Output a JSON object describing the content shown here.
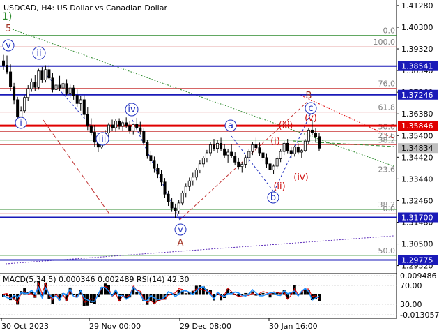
{
  "header": {
    "symbol": "USDCAD",
    "timeframe": "H4",
    "description": "US Dollar vs Canadian Dollar"
  },
  "colors": {
    "navy": "#1a1ab8",
    "red": "#e00000",
    "green": "#2e8b2e",
    "wave_blue": "#1f2fbf",
    "wave_red": "#d01010",
    "wave_brown": "#a03020",
    "fib_gray": "#808080",
    "candle": "#000000",
    "macd_hist": "#000000",
    "macd_signal": "#e00000",
    "rsi_line": "#1e90ff"
  },
  "chart_data": {
    "type": "candlestick",
    "symbol": "USDCAD",
    "timeframe": "H4",
    "y_range": [
      1.2916,
      1.4153
    ],
    "price_ticks": [
      "1.41280",
      "1.40300",
      "1.39320",
      "1.38340",
      "1.37360",
      "1.36380",
      "1.35400",
      "1.34420",
      "1.33440",
      "1.32460",
      "1.31480",
      "1.30500",
      "1.29520"
    ],
    "time_ticks": [
      "30 Oct 2023",
      "29 Nov 00:00",
      "29 Dec 08:00",
      "30 Jan 16:00"
    ],
    "levels": [
      {
        "price": 1.38541,
        "label": "1.38541",
        "color": "navy"
      },
      {
        "price": 1.37246,
        "label": "1.37246",
        "color": "navy"
      },
      {
        "price": 1.35846,
        "label": "1.35846",
        "color": "red"
      },
      {
        "price": 1.34834,
        "label": "1.34834",
        "color": "current"
      },
      {
        "price": 1.317,
        "label": "1.31700",
        "color": "navy"
      },
      {
        "price": 1.29775,
        "label": "1.29775",
        "color": "navy"
      }
    ],
    "fib_levels": [
      {
        "label": "0.0",
        "price": 1.3994,
        "color": "green"
      },
      {
        "label": "100.0",
        "price": 1.3941,
        "color": "red"
      },
      {
        "label": "76.0",
        "price": 1.3754,
        "color": "red"
      },
      {
        "label": "61.8",
        "price": 1.3646,
        "color": "red"
      },
      {
        "label": "50.0",
        "price": 1.3558,
        "color": "red"
      },
      {
        "label": "23.6",
        "price": 1.3519,
        "color": "green"
      },
      {
        "label": "38.2",
        "price": 1.3498,
        "color": "red"
      },
      {
        "label": "23.6",
        "price": 1.3366,
        "color": "red"
      },
      {
        "label": "38.2",
        "price": 1.3206,
        "color": "green"
      },
      {
        "label": "0.0",
        "price": 1.3187,
        "color": "red"
      },
      {
        "label": "50.0",
        "price": 1.2998,
        "color": "green"
      }
    ],
    "candles": [
      [
        1.3878,
        1.3905,
        1.3838,
        1.3858
      ],
      [
        1.3858,
        1.3902,
        1.3818,
        1.3828
      ],
      [
        1.3828,
        1.3862,
        1.3742,
        1.3762
      ],
      [
        1.3762,
        1.3778,
        1.3682,
        1.3702
      ],
      [
        1.3702,
        1.3715,
        1.3605,
        1.3625
      ],
      [
        1.3625,
        1.3672,
        1.3605,
        1.3652
      ],
      [
        1.3652,
        1.3722,
        1.3642,
        1.3712
      ],
      [
        1.3712,
        1.3768,
        1.3698,
        1.3752
      ],
      [
        1.3752,
        1.3798,
        1.3738,
        1.3782
      ],
      [
        1.3782,
        1.3815,
        1.3742,
        1.3758
      ],
      [
        1.3758,
        1.3842,
        1.3748,
        1.3832
      ],
      [
        1.3832,
        1.385,
        1.3778,
        1.3792
      ],
      [
        1.3792,
        1.3858,
        1.378,
        1.3838
      ],
      [
        1.3838,
        1.386,
        1.379,
        1.38
      ],
      [
        1.38,
        1.3822,
        1.3735,
        1.3748
      ],
      [
        1.3748,
        1.379,
        1.3705,
        1.3768
      ],
      [
        1.3768,
        1.381,
        1.3742,
        1.3755
      ],
      [
        1.3755,
        1.3785,
        1.3718,
        1.3775
      ],
      [
        1.3775,
        1.3795,
        1.3722,
        1.3732
      ],
      [
        1.3732,
        1.377,
        1.3712,
        1.3755
      ],
      [
        1.3755,
        1.3768,
        1.3702,
        1.3722
      ],
      [
        1.3722,
        1.3748,
        1.3668,
        1.3685
      ],
      [
        1.3685,
        1.372,
        1.3652,
        1.3702
      ],
      [
        1.3702,
        1.3722,
        1.362,
        1.3635
      ],
      [
        1.3635,
        1.3668,
        1.3565,
        1.3585
      ],
      [
        1.3585,
        1.3618,
        1.354,
        1.3555
      ],
      [
        1.3555,
        1.3588,
        1.349,
        1.351
      ],
      [
        1.351,
        1.3542,
        1.3465,
        1.3488
      ],
      [
        1.3488,
        1.3525,
        1.3478,
        1.3512
      ],
      [
        1.3512,
        1.3565,
        1.35,
        1.3552
      ],
      [
        1.3552,
        1.3598,
        1.3535,
        1.3588
      ],
      [
        1.3588,
        1.3612,
        1.3562,
        1.3575
      ],
      [
        1.3575,
        1.3615,
        1.3558,
        1.3605
      ],
      [
        1.3605,
        1.3618,
        1.3568,
        1.3582
      ],
      [
        1.3582,
        1.3608,
        1.356,
        1.3598
      ],
      [
        1.3598,
        1.3622,
        1.3575,
        1.3585
      ],
      [
        1.3585,
        1.3605,
        1.3548,
        1.3562
      ],
      [
        1.3562,
        1.3595,
        1.3545,
        1.359
      ],
      [
        1.359,
        1.362,
        1.3565,
        1.3575
      ],
      [
        1.3575,
        1.3602,
        1.3545,
        1.356
      ],
      [
        1.356,
        1.3572,
        1.3495,
        1.3508
      ],
      [
        1.3508,
        1.352,
        1.3435,
        1.345
      ],
      [
        1.345,
        1.3468,
        1.341,
        1.3428
      ],
      [
        1.3428,
        1.3445,
        1.3372,
        1.3392
      ],
      [
        1.3392,
        1.3412,
        1.3348,
        1.3365
      ],
      [
        1.3365,
        1.3385,
        1.3312,
        1.333
      ],
      [
        1.333,
        1.3348,
        1.3258,
        1.3275
      ],
      [
        1.3275,
        1.3292,
        1.3222,
        1.324
      ],
      [
        1.324,
        1.326,
        1.3195,
        1.3212
      ],
      [
        1.3212,
        1.3232,
        1.3168,
        1.3198
      ],
      [
        1.3198,
        1.325,
        1.3188,
        1.3235
      ],
      [
        1.3235,
        1.3292,
        1.3225,
        1.328
      ],
      [
        1.328,
        1.3325,
        1.3262,
        1.331
      ],
      [
        1.331,
        1.335,
        1.329,
        1.3335
      ],
      [
        1.3335,
        1.3372,
        1.3315,
        1.3352
      ],
      [
        1.3352,
        1.3395,
        1.3338,
        1.3385
      ],
      [
        1.3385,
        1.343,
        1.337,
        1.3412
      ],
      [
        1.3412,
        1.3448,
        1.3398,
        1.3438
      ],
      [
        1.3438,
        1.3475,
        1.342,
        1.3462
      ],
      [
        1.3462,
        1.351,
        1.3448,
        1.3498
      ],
      [
        1.3498,
        1.3525,
        1.347,
        1.3482
      ],
      [
        1.3482,
        1.352,
        1.3462,
        1.3505
      ],
      [
        1.3505,
        1.353,
        1.347,
        1.348
      ],
      [
        1.348,
        1.35,
        1.344,
        1.3452
      ],
      [
        1.3452,
        1.3478,
        1.3418,
        1.3465
      ],
      [
        1.3465,
        1.35,
        1.344,
        1.3448
      ],
      [
        1.3448,
        1.3465,
        1.3405,
        1.342
      ],
      [
        1.342,
        1.344,
        1.3388,
        1.34
      ],
      [
        1.34,
        1.342,
        1.3372,
        1.341
      ],
      [
        1.341,
        1.3452,
        1.3395,
        1.344
      ],
      [
        1.344,
        1.348,
        1.342,
        1.3468
      ],
      [
        1.3468,
        1.3512,
        1.3452,
        1.3498
      ],
      [
        1.3498,
        1.353,
        1.347,
        1.3485
      ],
      [
        1.3485,
        1.3508,
        1.3448,
        1.3462
      ],
      [
        1.3462,
        1.348,
        1.3425,
        1.344
      ],
      [
        1.344,
        1.346,
        1.3395,
        1.3412
      ],
      [
        1.3412,
        1.343,
        1.3372,
        1.3385
      ],
      [
        1.3385,
        1.341,
        1.3365,
        1.3402
      ],
      [
        1.3402,
        1.3445,
        1.339,
        1.3435
      ],
      [
        1.3435,
        1.3478,
        1.342,
        1.3468
      ],
      [
        1.3468,
        1.3515,
        1.3452,
        1.3505
      ],
      [
        1.3505,
        1.3525,
        1.346,
        1.3472
      ],
      [
        1.3472,
        1.349,
        1.344,
        1.3458
      ],
      [
        1.3458,
        1.3495,
        1.3445,
        1.3488
      ],
      [
        1.3488,
        1.3505,
        1.3455,
        1.3465
      ],
      [
        1.3465,
        1.348,
        1.344,
        1.3472
      ],
      [
        1.3472,
        1.3525,
        1.3465,
        1.3515
      ],
      [
        1.3515,
        1.3575,
        1.3502,
        1.3565
      ],
      [
        1.3565,
        1.361,
        1.354,
        1.3552
      ],
      [
        1.3552,
        1.3575,
        1.3512,
        1.3535
      ],
      [
        1.3535,
        1.3552,
        1.347,
        1.3483
      ]
    ]
  },
  "waves": {
    "a1": "1)",
    "a5": "5",
    "v1": "v",
    "ii": "ii",
    "i1": "i",
    "iii": "iii",
    "iv_blue": "iv",
    "v2": "v",
    "A": "A",
    "a_blue": "a",
    "b_blue": "b",
    "c_blue": "c",
    "B": "B",
    "i_red": "(i)",
    "ii_red": "(ii)",
    "iii_red": "(iii)",
    "iv_red": "(iv)",
    "v_red": "(v)"
  },
  "indicator": {
    "label": "MACD(5,34,5) 0.000346 0.002489 RSI(14) 42.30",
    "levels": [
      "0.009486",
      "70.00",
      "30.00",
      "-0.013057"
    ]
  }
}
